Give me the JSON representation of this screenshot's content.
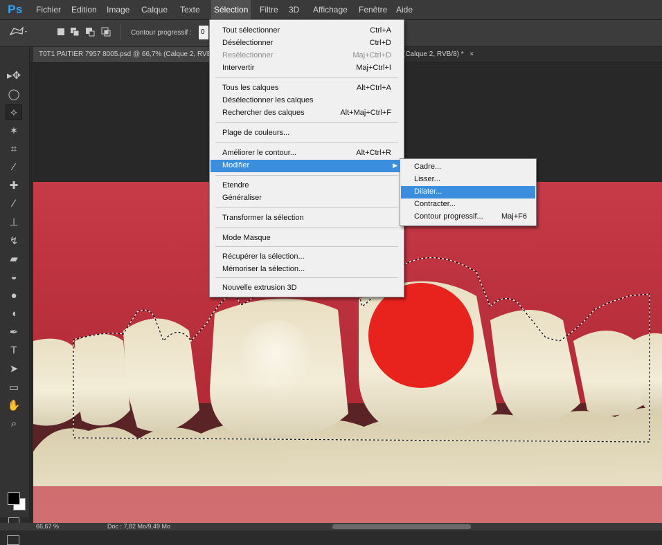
{
  "app": {
    "logo": "Ps"
  },
  "menubar": {
    "items": [
      "Fichier",
      "Edition",
      "Image",
      "Calque",
      "Texte",
      "Sélection",
      "Filtre",
      "3D",
      "Affichage",
      "Fenêtre",
      "Aide"
    ],
    "open_item": "Sélection"
  },
  "options_bar": {
    "contour_label": "Contour progressif :",
    "contour_value": "0",
    "icons": [
      "lasso-polygonal-icon",
      "new-selection-icon",
      "add-to-selection-icon",
      "subtract-selection-icon",
      "intersect-selection-icon"
    ]
  },
  "document_tabs": [
    {
      "title": "T0T1 PAITIER 7957 8005.psd @ 66,7% (Calque 2, RVB/8) *",
      "active": true
    },
    {
      "title": "(Calque 2, RVB/8) *",
      "close": "×",
      "active": false
    }
  ],
  "selection_menu": {
    "items": [
      {
        "label": "Tout sélectionner",
        "shortcut": "Ctrl+A",
        "state": "normal"
      },
      {
        "label": "Désélectionner",
        "shortcut": "Ctrl+D",
        "state": "normal"
      },
      {
        "label": "Resélectionner",
        "shortcut": "Maj+Ctrl+D",
        "state": "disabled"
      },
      {
        "label": "Intervertir",
        "shortcut": "Maj+Ctrl+I",
        "state": "normal"
      },
      {
        "label": "Tous les calques",
        "shortcut": "Alt+Ctrl+A",
        "state": "normal"
      },
      {
        "label": "Désélectionner les calques",
        "shortcut": "",
        "state": "normal"
      },
      {
        "label": "Rechercher des calques",
        "shortcut": "Alt+Maj+Ctrl+F",
        "state": "normal"
      },
      {
        "label": "Plage de couleurs...",
        "shortcut": "",
        "state": "normal"
      },
      {
        "label": "Améliorer le contour...",
        "shortcut": "Alt+Ctrl+R",
        "state": "normal"
      },
      {
        "label": "Modifier",
        "shortcut": "",
        "state": "highlighted",
        "submenu": true
      },
      {
        "label": "Etendre",
        "shortcut": "",
        "state": "normal"
      },
      {
        "label": "Généraliser",
        "shortcut": "",
        "state": "normal"
      },
      {
        "label": "Transformer la sélection",
        "shortcut": "",
        "state": "normal"
      },
      {
        "label": "Mode Masque",
        "shortcut": "",
        "state": "normal"
      },
      {
        "label": "Récupérer la sélection...",
        "shortcut": "",
        "state": "normal"
      },
      {
        "label": "Mémoriser la sélection...",
        "shortcut": "",
        "state": "normal"
      },
      {
        "label": "Nouvelle extrusion 3D",
        "shortcut": "",
        "state": "normal"
      }
    ]
  },
  "modifier_submenu": {
    "items": [
      {
        "label": "Cadre...",
        "shortcut": "",
        "state": "normal"
      },
      {
        "label": "Lisser...",
        "shortcut": "",
        "state": "normal"
      },
      {
        "label": "Dilater...",
        "shortcut": "",
        "state": "highlighted"
      },
      {
        "label": "Contracter...",
        "shortcut": "",
        "state": "normal"
      },
      {
        "label": "Contour progressif...",
        "shortcut": "Maj+F6",
        "state": "normal"
      }
    ]
  },
  "toolbar": {
    "tools": [
      {
        "name": "move-tool-icon",
        "glyph": "▸✥",
        "active": false
      },
      {
        "name": "elliptical-marquee-icon",
        "glyph": "◯",
        "active": false
      },
      {
        "name": "polygonal-lasso-icon",
        "glyph": "⟡",
        "active": true
      },
      {
        "name": "magic-wand-icon",
        "glyph": "✶",
        "active": false
      },
      {
        "name": "crop-tool-icon",
        "glyph": "⌗",
        "active": false
      },
      {
        "name": "eyedropper-icon",
        "glyph": "⁄",
        "active": false
      },
      {
        "name": "healing-brush-icon",
        "glyph": "✚",
        "active": false
      },
      {
        "name": "brush-tool-icon",
        "glyph": "∕",
        "active": false
      },
      {
        "name": "clone-stamp-icon",
        "glyph": "⊥",
        "active": false
      },
      {
        "name": "history-brush-icon",
        "glyph": "↯",
        "active": false
      },
      {
        "name": "eraser-icon",
        "glyph": "▰",
        "active": false
      },
      {
        "name": "paint-bucket-icon",
        "glyph": "◒",
        "active": false
      },
      {
        "name": "blur-tool-icon",
        "glyph": "●",
        "active": false
      },
      {
        "name": "dodge-tool-icon",
        "glyph": "◖",
        "active": false
      },
      {
        "name": "pen-tool-icon",
        "glyph": "✒",
        "active": false
      },
      {
        "name": "type-tool-icon",
        "glyph": "T",
        "active": false
      },
      {
        "name": "path-selection-icon",
        "glyph": "➤",
        "active": false
      },
      {
        "name": "rectangle-tool-icon",
        "glyph": "▭",
        "active": false
      },
      {
        "name": "hand-tool-icon",
        "glyph": "✋",
        "active": false
      },
      {
        "name": "zoom-tool-icon",
        "glyph": "⌕",
        "active": false
      }
    ],
    "foreground_color": "#000000",
    "background_color": "#ffffff"
  },
  "status_bar": {
    "zoom": "66,67 %",
    "doc": "Doc : 7,82 Mo/9,49 Mo"
  }
}
